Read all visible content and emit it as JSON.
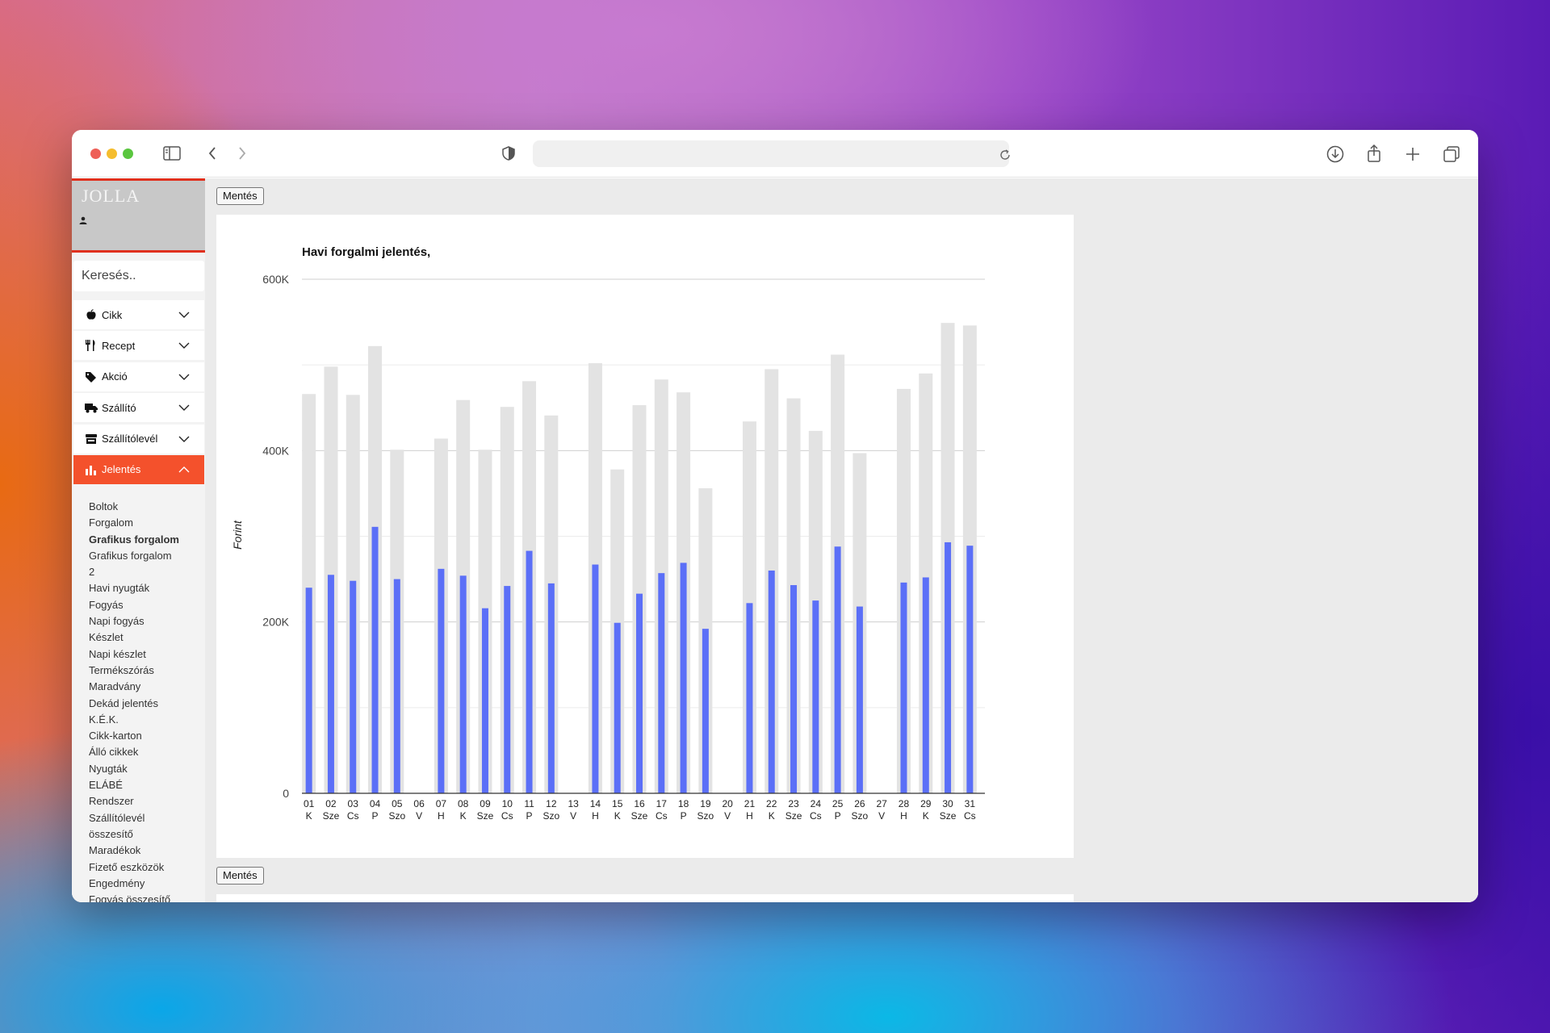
{
  "browser": {
    "url": "",
    "icons": [
      "sidebar-toggle-icon",
      "back-icon",
      "forward-icon",
      "shield-icon",
      "reload-icon",
      "download-icon",
      "share-icon",
      "new-tab-icon",
      "tabs-overview-icon"
    ]
  },
  "app": {
    "logo": "JOLLA",
    "user": "",
    "search_placeholder": "Keresés..",
    "save_label": "Mentés",
    "accent_color": "#f4512c",
    "menu": [
      {
        "label": "Cikk",
        "icon": "apple-icon"
      },
      {
        "label": "Recept",
        "icon": "utensils-icon"
      },
      {
        "label": "Akció",
        "icon": "tags-icon"
      },
      {
        "label": "Szállító",
        "icon": "truck-icon"
      },
      {
        "label": "Szállítólevél",
        "icon": "store-icon"
      },
      {
        "label": "Jelentés",
        "icon": "bar-chart-icon",
        "active": true
      }
    ],
    "submenu": [
      "Boltok",
      "Forgalom",
      "Grafikus forgalom",
      "Grafikus forgalom",
      "2",
      "Havi nyugták",
      "Fogyás",
      "Napi fogyás",
      "Készlet",
      "Napi készlet",
      "Termékszórás",
      "Maradvány",
      "Dekád jelentés",
      "K.É.K.",
      "Cikk-karton",
      "Álló cikkek",
      "Nyugták",
      "ELÁBÉ",
      "Rendszer",
      "Szállítólevél",
      "összesítő",
      "Maradékok",
      "Fizető eszközök",
      "Engedmény",
      "Fogyás összesítő"
    ],
    "submenu_bold_index": 2
  },
  "chart_data": {
    "type": "bar",
    "title": "Havi forgalmi jelentés,",
    "ylabel": "Forint",
    "ylim": [
      0,
      600000
    ],
    "yticks": [
      "0",
      "200K",
      "400K",
      "600K"
    ],
    "grid": true,
    "days": [
      "01",
      "02",
      "03",
      "04",
      "05",
      "06",
      "07",
      "08",
      "09",
      "10",
      "11",
      "12",
      "13",
      "14",
      "15",
      "16",
      "17",
      "18",
      "19",
      "20",
      "21",
      "22",
      "23",
      "24",
      "25",
      "26",
      "27",
      "28",
      "29",
      "30",
      "31"
    ],
    "weekdays": [
      "K",
      "Sze",
      "Cs",
      "P",
      "Szo",
      "V",
      "H",
      "K",
      "Sze",
      "Cs",
      "P",
      "Szo",
      "V",
      "H",
      "K",
      "Sze",
      "Cs",
      "P",
      "Szo",
      "V",
      "H",
      "K",
      "Sze",
      "Cs",
      "P",
      "Szo",
      "V",
      "H",
      "K",
      "Sze",
      "Cs"
    ],
    "series": [
      {
        "color": "#e3e3e3",
        "values": [
          466000,
          498000,
          465000,
          522000,
          401000,
          0,
          414000,
          459000,
          401000,
          451000,
          481000,
          441000,
          0,
          502000,
          378000,
          453000,
          483000,
          468000,
          356000,
          0,
          434000,
          495000,
          461000,
          423000,
          512000,
          397000,
          0,
          472000,
          490000,
          549000,
          546000
        ]
      },
      {
        "color": "#5b6ff7",
        "values": [
          240000,
          255000,
          248000,
          311000,
          250000,
          0,
          262000,
          254000,
          216000,
          242000,
          283000,
          245000,
          0,
          267000,
          199000,
          233000,
          257000,
          269000,
          192000,
          0,
          222000,
          260000,
          243000,
          225000,
          288000,
          218000,
          0,
          246000,
          252000,
          293000,
          289000
        ]
      }
    ]
  }
}
